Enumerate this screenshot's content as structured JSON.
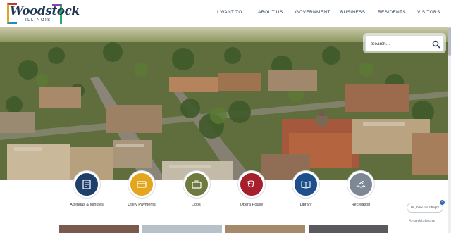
{
  "logo": {
    "name": "Woodstock",
    "sub": "ILLINOIS"
  },
  "nav": [
    {
      "label": "I WANT TO..."
    },
    {
      "label": "ABOUT US"
    },
    {
      "label": "GOVERNMENT"
    },
    {
      "label": "BUSINESS"
    },
    {
      "label": "RESIDENTS"
    },
    {
      "label": "VISITORS"
    }
  ],
  "search": {
    "placeholder": "Search..."
  },
  "quick_links": [
    {
      "label": "Agendas & Minutes",
      "color": "#1f3f6b",
      "icon": "agenda-icon"
    },
    {
      "label": "Utility Payments",
      "color": "#e5a61f",
      "icon": "payment-icon"
    },
    {
      "label": "Jobs",
      "color": "#6f7a3f",
      "icon": "jobs-icon"
    },
    {
      "label": "Opera House",
      "color": "#a51f2d",
      "icon": "theater-masks-icon"
    },
    {
      "label": "Library",
      "color": "#1f4f8a",
      "icon": "book-icon"
    },
    {
      "label": "Recreation",
      "color": "#7d8894",
      "icon": "swim-icon"
    }
  ],
  "chat": {
    "text": "Hi , how can I help?",
    "close": "×"
  },
  "watermark": "ScanMalware",
  "colors": {
    "navy": "#1f3552",
    "white": "#ffffff"
  }
}
